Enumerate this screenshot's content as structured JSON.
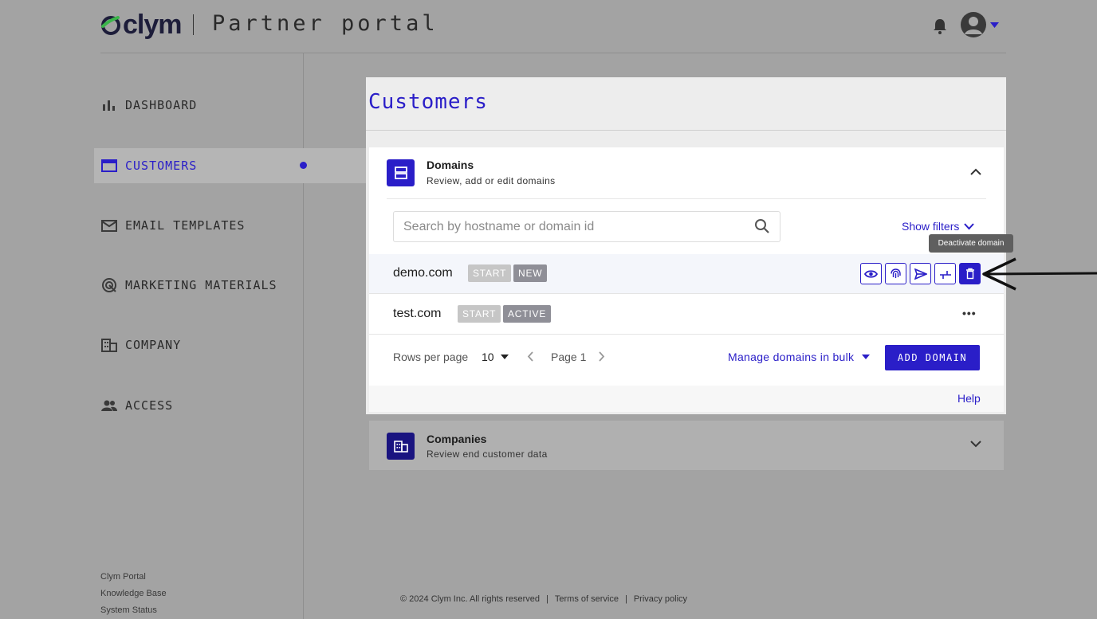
{
  "header": {
    "brand": "clym",
    "portal_title": "Partner portal",
    "icons": {
      "notifications": "bell-icon",
      "user": "avatar-icon",
      "menu": "caret-down-icon"
    }
  },
  "sidebar": {
    "items": [
      {
        "label": "DASHBOARD",
        "icon": "bar-chart-icon",
        "active": false
      },
      {
        "label": "CUSTOMERS",
        "icon": "folder-icon",
        "active": true
      },
      {
        "label": "EMAIL TEMPLATES",
        "icon": "envelope-icon",
        "active": false
      },
      {
        "label": "MARKETING MATERIALS",
        "icon": "target-icon",
        "active": false
      },
      {
        "label": "COMPANY",
        "icon": "building-icon",
        "active": false
      },
      {
        "label": "ACCESS",
        "icon": "people-icon",
        "active": false
      }
    ],
    "footer_links": [
      "Clym Portal",
      "Knowledge Base",
      "System Status"
    ]
  },
  "main": {
    "title": "Customers",
    "domains_card": {
      "title": "Domains",
      "subtitle": "Review, add or edit domains",
      "search_placeholder": "Search by hostname or domain id",
      "show_filters": "Show filters",
      "tooltip": "Deactivate domain",
      "rows": [
        {
          "domain": "demo.com",
          "plan": "START",
          "status": "NEW"
        },
        {
          "domain": "test.com",
          "plan": "START",
          "status": "ACTIVE",
          "more": "•••"
        }
      ],
      "row_actions": [
        "view-eye-icon",
        "fingerprint-icon",
        "send-icon",
        "merge-icon",
        "trash-icon"
      ],
      "pagination": {
        "rows_label": "Rows per page",
        "rows_value": "10",
        "page_label": "Page 1"
      },
      "bulk_label": "Manage domains in bulk",
      "add_button": "ADD DOMAIN",
      "help": "Help"
    },
    "companies_card": {
      "title": "Companies",
      "subtitle": "Review end customer data"
    }
  },
  "footer": {
    "copyright": "© 2024 Clym Inc. All rights reserved",
    "sep": "|",
    "terms": "Terms of service",
    "privacy": "Privacy policy"
  },
  "colors": {
    "accent": "#2a1ec8",
    "overlay_bg": "#a3a3a3",
    "badge_grey": "#c6c6c6",
    "badge_dark": "#8f8f97"
  }
}
